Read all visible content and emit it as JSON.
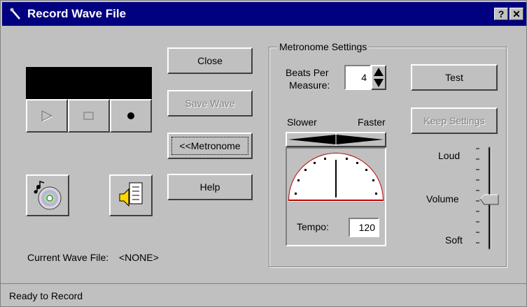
{
  "window": {
    "title": "Record Wave File",
    "help_button": "?",
    "close_button": "✕"
  },
  "buttons": {
    "close": "Close",
    "save_wave": "Save Wave",
    "metronome": "<<Metronome",
    "help": "Help",
    "test": "Test",
    "keep_settings": "Keep Settings"
  },
  "transport": {
    "play": "play-icon",
    "stop": "stop-icon",
    "record": "record-icon"
  },
  "current_wave": {
    "label": "Current Wave File:",
    "value": "<NONE>"
  },
  "metronome": {
    "group_title": "Metronome Settings",
    "beats_label_line1": "Beats Per",
    "beats_label_line2": "Measure:",
    "beats_value": "4",
    "slower_label": "Slower",
    "faster_label": "Faster",
    "tempo_label": "Tempo:",
    "tempo_value": "120",
    "volume": {
      "loud_label": "Loud",
      "volume_label": "Volume",
      "soft_label": "Soft",
      "level": 0.5
    }
  },
  "status": {
    "text": "Ready to Record"
  },
  "colors": {
    "titlebar": "#000080",
    "face": "#c0c0c0",
    "dial_arc": "#c00000"
  }
}
